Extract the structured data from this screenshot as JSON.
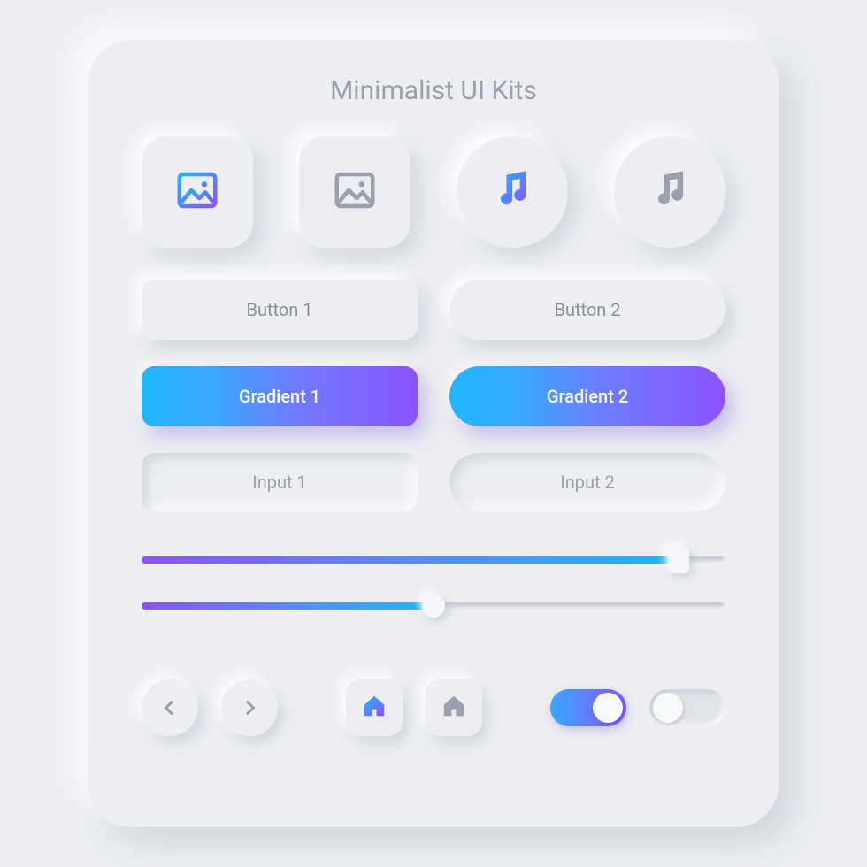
{
  "title": "Minimalist UI Kits",
  "tiles": {
    "image_grad": "image-icon",
    "image_grey": "image-icon",
    "music_grad": "music-note-icon",
    "music_grey": "music-note-icon"
  },
  "buttons": {
    "rect_label": "Button 1",
    "pill_label": "Button 2",
    "grad_rect_label": "Gradient 1",
    "grad_pill_label": "Gradient 2"
  },
  "inputs": {
    "rect_placeholder": "Input 1",
    "pill_placeholder": "Input 2"
  },
  "sliders": {
    "slider1_percent": 92,
    "slider2_percent": 50
  },
  "toggles": {
    "toggle1_on": true,
    "toggle2_on": false
  },
  "colors": {
    "grad_start": "#1fb6ff",
    "grad_end": "#8c52ff",
    "text_muted": "#9aa0ad"
  }
}
